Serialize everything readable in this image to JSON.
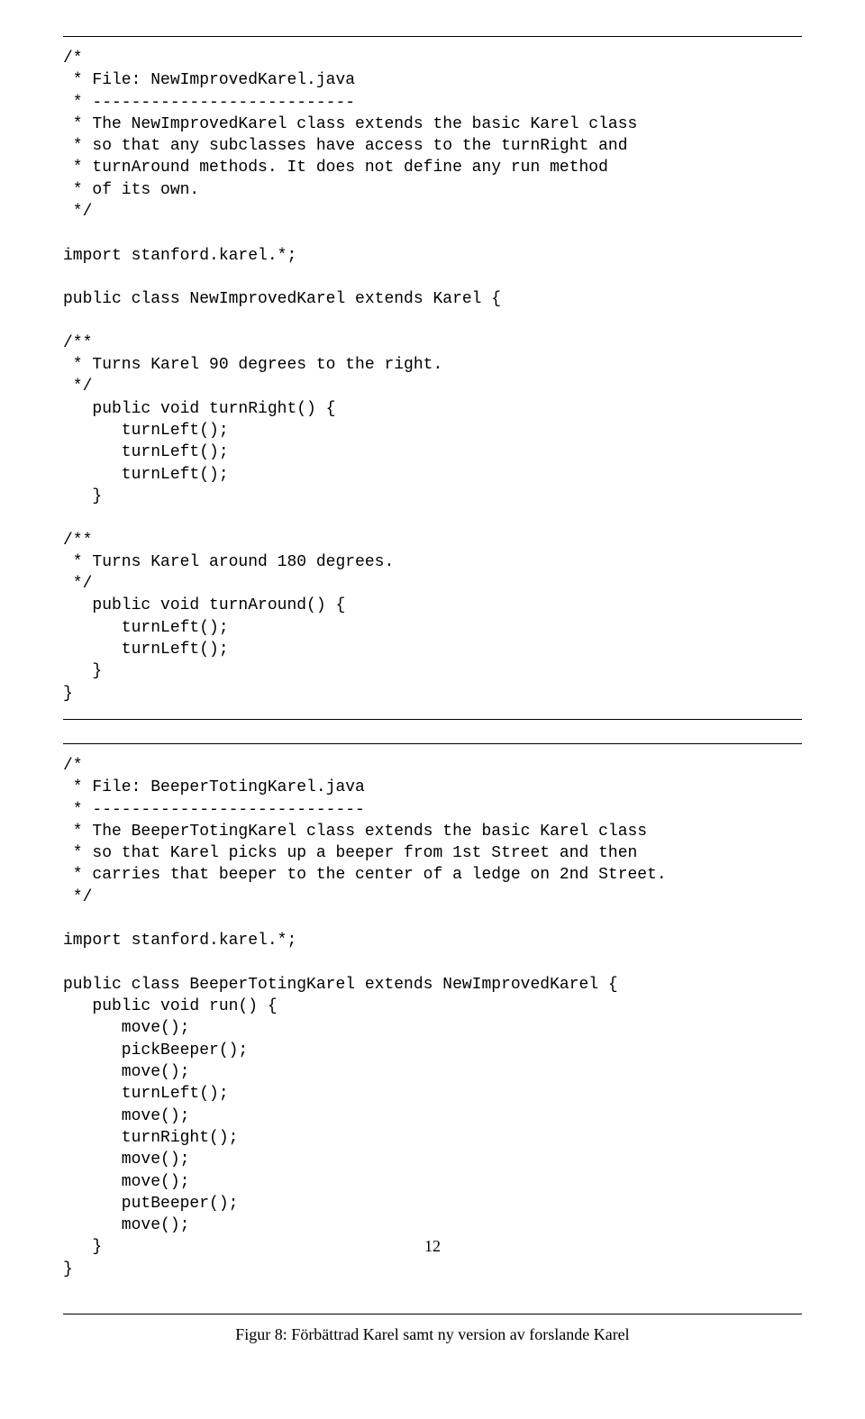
{
  "code1": {
    "lines": [
      "/*",
      " * File: NewImprovedKarel.java",
      " * ---------------------------",
      " * The NewImprovedKarel class extends the basic Karel class",
      " * so that any subclasses have access to the turnRight and",
      " * turnAround methods. It does not define any run method",
      " * of its own.",
      " */",
      "",
      "import stanford.karel.*;",
      "",
      "public class NewImprovedKarel extends Karel {",
      "",
      "/**",
      " * Turns Karel 90 degrees to the right.",
      " */",
      "   public void turnRight() {",
      "      turnLeft();",
      "      turnLeft();",
      "      turnLeft();",
      "   }",
      "",
      "/**",
      " * Turns Karel around 180 degrees.",
      " */",
      "   public void turnAround() {",
      "      turnLeft();",
      "      turnLeft();",
      "   }",
      "}"
    ]
  },
  "code2": {
    "lines": [
      "/*",
      " * File: BeeperTotingKarel.java",
      " * ----------------------------",
      " * The BeeperTotingKarel class extends the basic Karel class",
      " * so that Karel picks up a beeper from 1st Street and then",
      " * carries that beeper to the center of a ledge on 2nd Street.",
      " */",
      "",
      "import stanford.karel.*;",
      "",
      "public class BeeperTotingKarel extends NewImprovedKarel {",
      "   public void run() {",
      "      move();",
      "      pickBeeper();",
      "      move();",
      "      turnLeft();",
      "      move();",
      "      turnRight();",
      "      move();",
      "      move();",
      "      putBeeper();",
      "      move();",
      "   }",
      "}"
    ]
  },
  "page_number": "12",
  "caption": "Figur 8: Förbättrad Karel samt ny version av forslande Karel"
}
